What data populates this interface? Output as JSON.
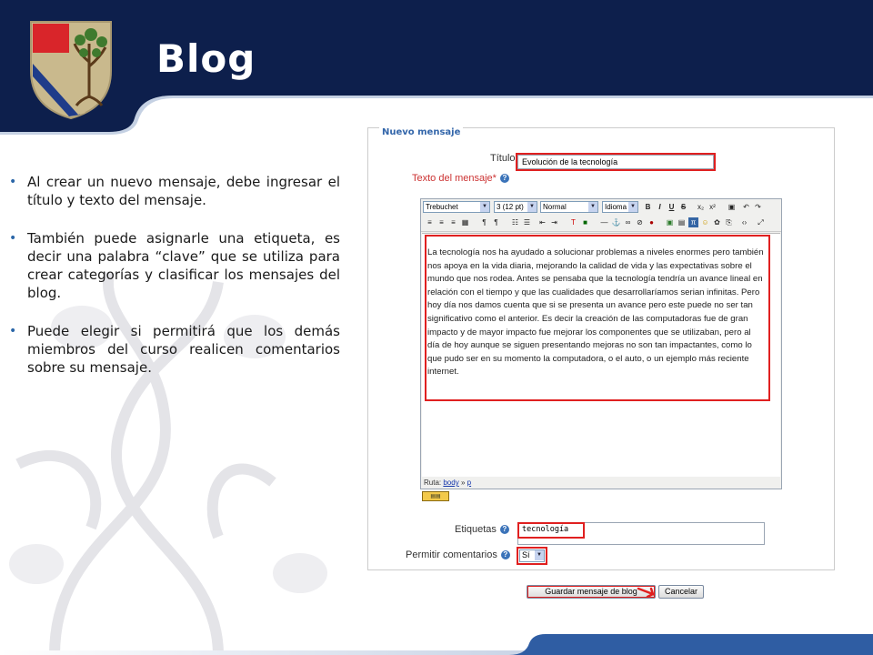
{
  "slide": {
    "title": "Blog",
    "bullets": [
      "Al crear un nuevo mensaje, debe ingresar el título y texto del mensaje.",
      "También puede asignarle una etiqueta, es decir una palabra “clave” que se utiliza para crear categorías y clasificar los mensajes del blog.",
      "Puede elegir si permitirá que los demás miembros del curso realicen comentarios sobre su mensaje."
    ]
  },
  "colors": {
    "navy": "#0d1f4c",
    "accent_blue": "#2c67a8",
    "highlight_red": "#e02020"
  },
  "form": {
    "legend": "Nuevo mensaje",
    "title_label": "Título",
    "title_value": "Evolución de la tecnología",
    "body_label": "Texto del mensaje*",
    "toolbar": {
      "font": "Trebuchet",
      "size": "3 (12 pt)",
      "style": "Normal",
      "language": "Idioma"
    },
    "body_text": "La tecnología nos ha ayudado a solucionar problemas a niveles enormes pero también nos apoya en la vida diaria, mejorando la calidad de vida y las expectativas sobre el mundo que nos rodea. Antes se pensaba que la tecnología tendría un avance lineal en relación con el tiempo y que las cualidades que desarrollaríamos serian infinitas. Pero hoy día nos damos cuenta que si se presenta un avance pero este puede no ser tan significativo como el anterior. Es decir la creación de las computadoras fue de gran impacto y de mayor impacto fue mejorar los componentes que se utilizaban, pero al día de hoy aunque se siguen presentando mejoras no son tan impactantes, como lo que pudo ser en su momento la computadora, o el auto, o un ejemplo más reciente internet.",
    "path_label": "Ruta:",
    "path_body": "body",
    "path_sep": "»",
    "path_p": "p",
    "tags_label": "Etiquetas",
    "tags_value": "tecnología",
    "comments_label": "Permitir comentarios",
    "comments_value": "Sí",
    "save_button": "Guardar mensaje de blog",
    "cancel_button": "Cancelar"
  }
}
